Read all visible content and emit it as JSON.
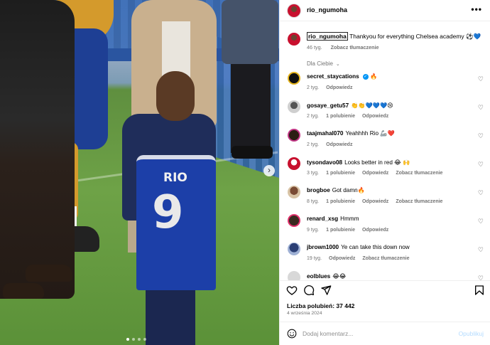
{
  "post": {
    "jersey_name": "RIO",
    "jersey_number": "9"
  },
  "header": {
    "username": "rio_ngumoha",
    "more_label": "•••"
  },
  "caption": {
    "username": "rio_ngumoha",
    "text": "Thankyou for everything Chelsea academy ⚽💙",
    "time": "46 tyg.",
    "translate": "Zobacz tłumaczenie"
  },
  "section_label": "Dla Ciebie",
  "comments": [
    {
      "user": "secret_staycations",
      "verified": true,
      "text": "🔥",
      "time": "2 tyg.",
      "likes": "",
      "reply": "Odpowiedz",
      "translate": ""
    },
    {
      "user": "gosaye_getu57",
      "verified": false,
      "text": "👏👏💙💙💙😢",
      "time": "2 tyg.",
      "likes": "1 polubienie",
      "reply": "Odpowiedz",
      "translate": ""
    },
    {
      "user": "taajmahal070",
      "verified": false,
      "text": "Yeahhhh Rio 🦾❤️",
      "time": "2 tyg.",
      "likes": "",
      "reply": "Odpowiedz",
      "translate": ""
    },
    {
      "user": "tysondavo08",
      "verified": false,
      "text": "Looks better in red 😂 🙌",
      "time": "3 tyg.",
      "likes": "1 polubienie",
      "reply": "Odpowiedz",
      "translate": "Zobacz tłumaczenie"
    },
    {
      "user": "brogboe",
      "verified": false,
      "text": "Got damn🔥",
      "time": "8 tyg.",
      "likes": "1 polubienie",
      "reply": "Odpowiedz",
      "translate": "Zobacz tłumaczenie"
    },
    {
      "user": "renard_xsg",
      "verified": false,
      "text": "Hmmm",
      "time": "9 tyg.",
      "likes": "1 polubienie",
      "reply": "Odpowiedz",
      "translate": ""
    },
    {
      "user": "jbrown1000",
      "verified": false,
      "text": "Ye can take this down now",
      "time": "19 tyg.",
      "likes": "",
      "reply": "Odpowiedz",
      "translate": "Zobacz tłumaczenie"
    },
    {
      "user": "eolblues",
      "verified": false,
      "text": "😂😂",
      "time": "",
      "likes": "",
      "reply": "",
      "translate": ""
    }
  ],
  "footer": {
    "likes_label": "Liczba polubień: 37 442",
    "date": "4 września 2024",
    "comment_placeholder": "Dodaj komentarz...",
    "post_label": "Opublikuj"
  },
  "icons": {
    "like": "heart-icon",
    "comment": "comment-bubble-icon",
    "share": "paper-plane-icon",
    "save": "bookmark-icon",
    "emoji": "smiley-icon"
  },
  "colors": {
    "accent": "#0095f6",
    "post_disabled": "#b3dbff",
    "secondary_text": "#737373"
  }
}
